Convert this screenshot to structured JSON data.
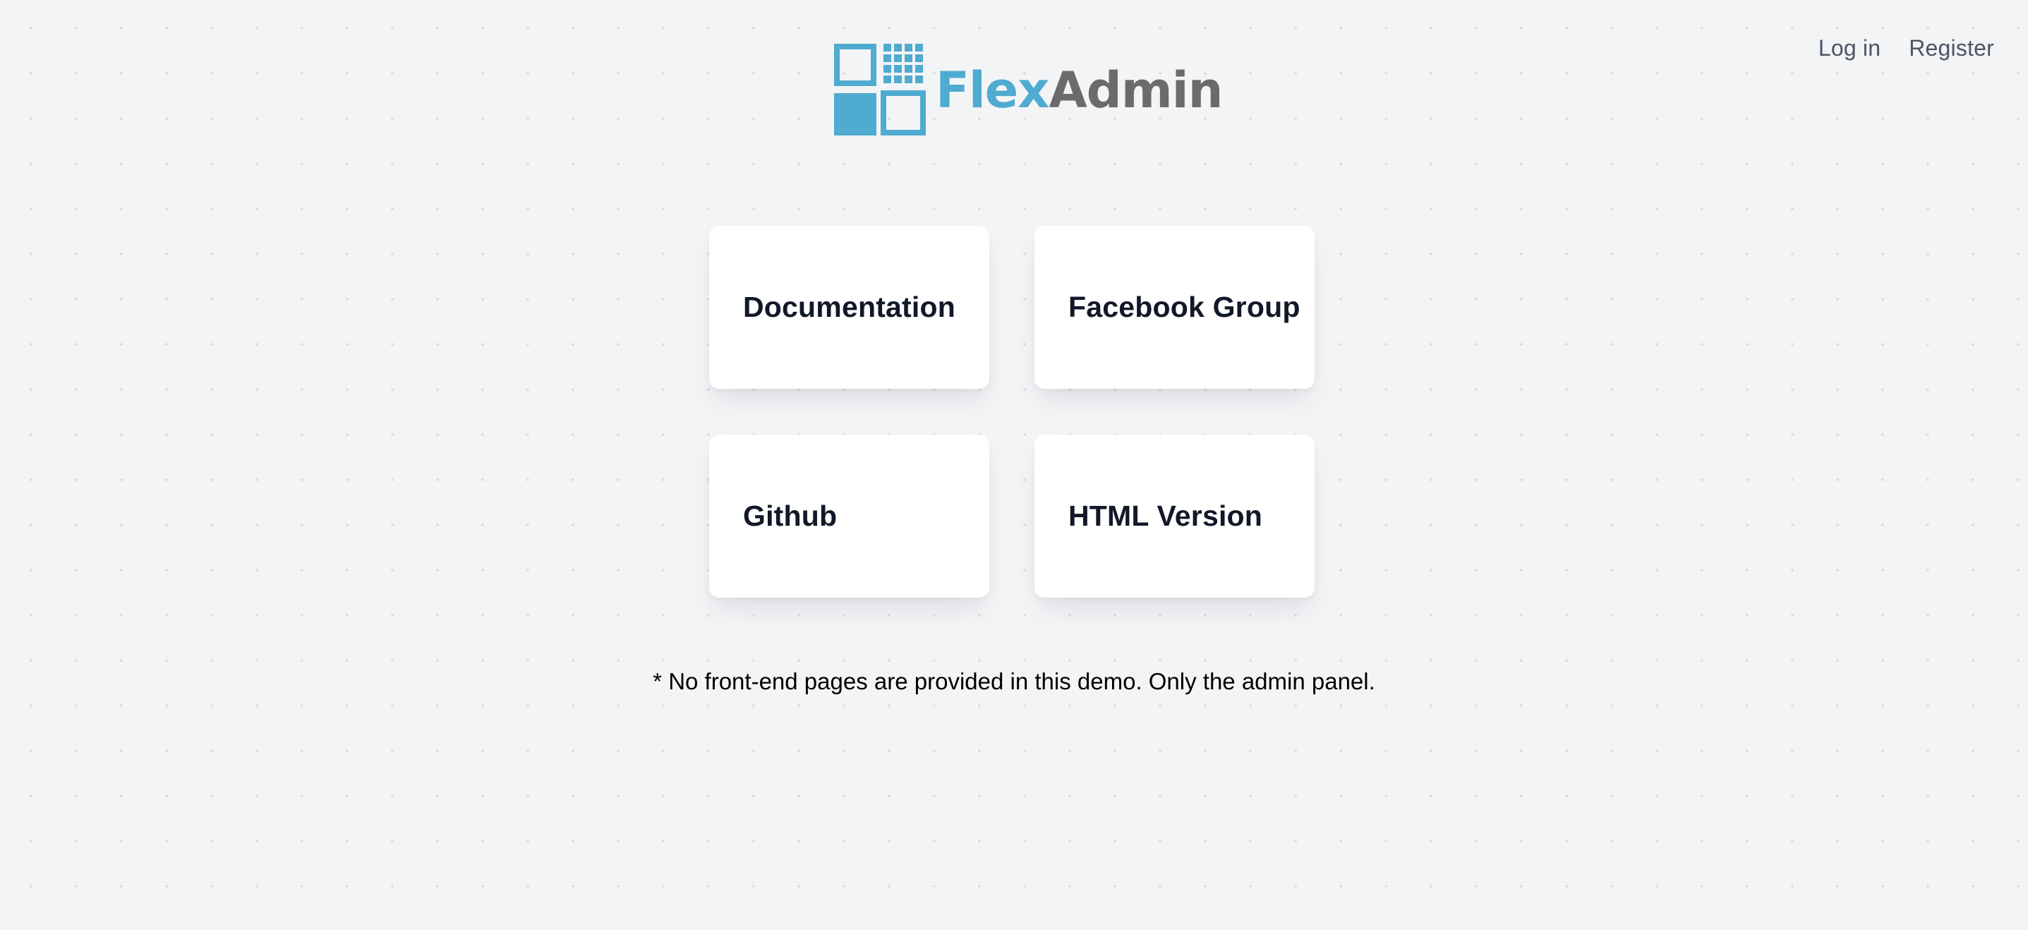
{
  "brand": {
    "logo_part1": "Flex",
    "logo_part2": "Admin",
    "color_primary": "#4fabcf",
    "color_secondary": "#6b6b6b"
  },
  "nav": {
    "login": "Log in",
    "register": "Register"
  },
  "cards": [
    {
      "label": "Documentation"
    },
    {
      "label": "Facebook Group"
    },
    {
      "label": "Github"
    },
    {
      "label": "HTML Version"
    }
  ],
  "note": "* No front-end pages are provided in this demo. Only the admin panel."
}
